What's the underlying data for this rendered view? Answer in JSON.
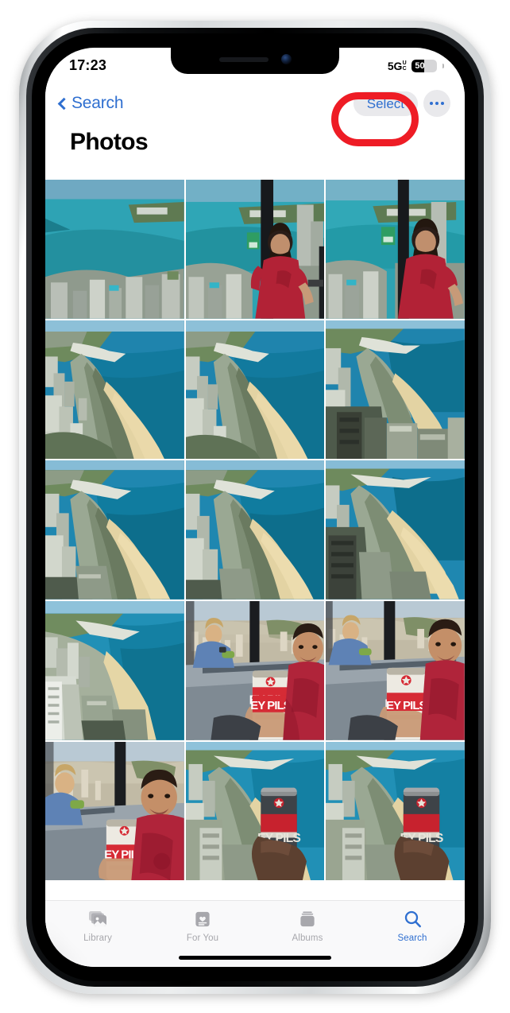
{
  "device": {
    "name": "iphone-silver",
    "frame_color": "#d7dadc",
    "bezel_color": "#000000"
  },
  "statusbar": {
    "time": "17:23",
    "network_label": "5G",
    "network_sub_top": "U",
    "network_sub_bottom": "C",
    "battery_percent": "50",
    "battery_fill_ratio": 52
  },
  "navbar": {
    "back_label": "Search",
    "select_label": "Select",
    "more_label": "···",
    "accent_color": "#2f6fd0"
  },
  "header": {
    "title": "Photos"
  },
  "annotation": {
    "shape": "circle",
    "color": "#ee1c25",
    "target": "Select"
  },
  "grid": {
    "columns": 3,
    "photos": [
      {
        "id": "p1",
        "caption": "Aerial view of Lake Michigan and Navy Pier from above",
        "scene": "aerial-lake"
      },
      {
        "id": "p2",
        "caption": "Woman in red shirt at observation deck window over lake",
        "scene": "woman-window"
      },
      {
        "id": "p3",
        "caption": "Woman in red shirt at observation deck window over lake",
        "scene": "woman-window"
      },
      {
        "id": "p4",
        "caption": "Aerial view of Lake Shore Drive and North Avenue Beach",
        "scene": "aerial-beach"
      },
      {
        "id": "p5",
        "caption": "Aerial view of Lake Shore Drive and North Avenue Beach",
        "scene": "aerial-beach"
      },
      {
        "id": "p6",
        "caption": "Aerial view of Lake Shore Drive and beach with buildings",
        "scene": "aerial-beach"
      },
      {
        "id": "p7",
        "caption": "Aerial view of lakefront drive curving along the beach",
        "scene": "aerial-beach"
      },
      {
        "id": "p8",
        "caption": "Aerial view of lakefront drive curving along the beach",
        "scene": "aerial-beach"
      },
      {
        "id": "p9",
        "caption": "Aerial view of lakefront drive curving along the beach",
        "scene": "aerial-beach"
      },
      {
        "id": "p10",
        "caption": "Aerial view of downtown skyline along the lake",
        "scene": "aerial-lake"
      },
      {
        "id": "p11",
        "caption": "Selfie holding a HEY PILS beer can at skydeck window",
        "scene": "selfie-can"
      },
      {
        "id": "p12",
        "caption": "Selfie holding a HEY PILS beer can at skydeck window",
        "scene": "selfie-can"
      },
      {
        "id": "p13",
        "caption": "Selfie holding a HEY PILS beer can at skydeck window",
        "scene": "selfie-can"
      },
      {
        "id": "p14",
        "caption": "HEY PILS beer can held over aerial lakefront view",
        "scene": "can-aerial"
      },
      {
        "id": "p15",
        "caption": "HEY PILS beer can held over aerial lakefront view",
        "scene": "can-aerial"
      }
    ],
    "beer_can_label": "HEY PILS"
  },
  "tabbar": {
    "tabs": [
      {
        "label": "Library",
        "icon": "photo-stack-icon",
        "active": false
      },
      {
        "label": "For You",
        "icon": "heart-card-icon",
        "active": false
      },
      {
        "label": "Albums",
        "icon": "albums-icon",
        "active": false
      },
      {
        "label": "Search",
        "icon": "search-icon",
        "active": true
      }
    ],
    "inactive_color": "#a7a7ac",
    "active_color": "#2f6fd0"
  }
}
